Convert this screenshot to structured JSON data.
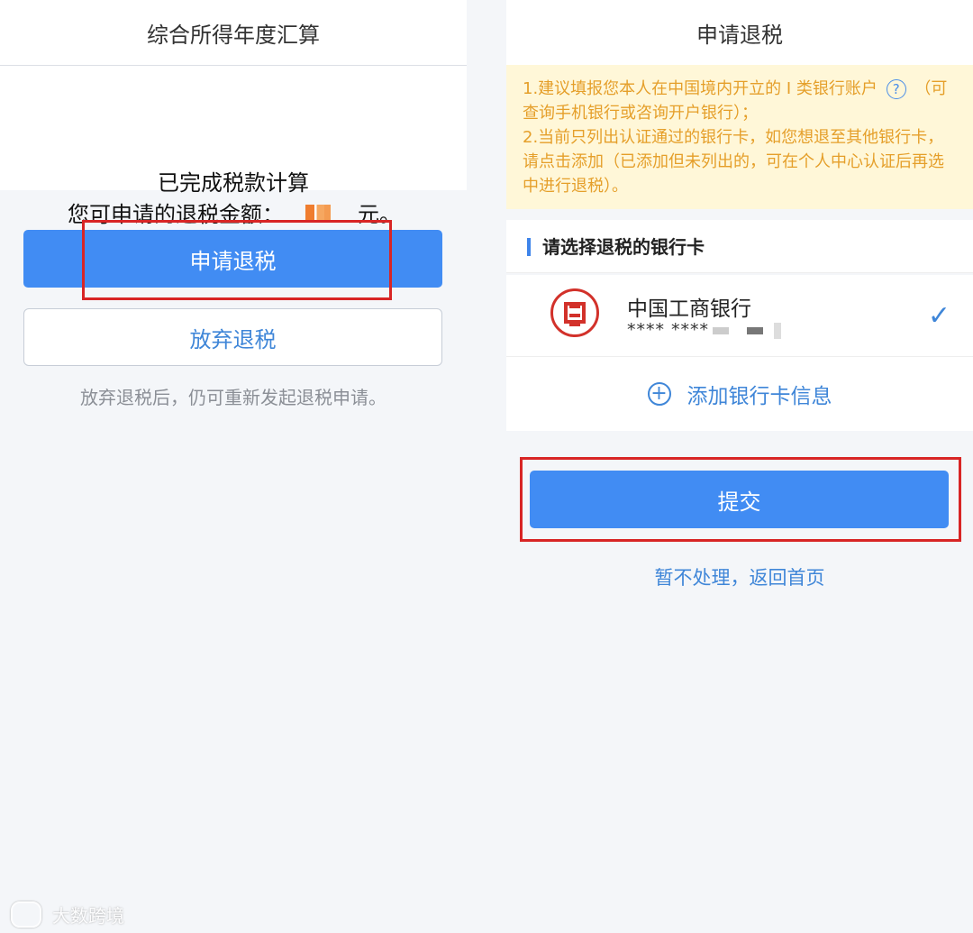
{
  "left": {
    "title": "综合所得年度汇算",
    "done_text": "已完成税款计算",
    "amount_label": "您可申请的退税金额：",
    "amount_suffix": "元。",
    "apply_button": "申请退税",
    "abandon_button": "放弃退税",
    "hint": "放弃退税后，仍可重新发起退税申请。"
  },
  "right": {
    "title": "申请退税",
    "notice": [
      "1.建议填报您本人在中国境内开立的 I 类银行账户",
      "（可查询手机银行或咨询开户银行）；",
      "2.当前只列出认证通过的银行卡，如您想退至其他银行卡，请点击添加（已添加但未列出的，可在个人中心认证后再选中进行退税）。"
    ],
    "section_title": "请选择退税的银行卡",
    "bank_name": "中国工商银行",
    "card_number": "**** ****",
    "add_card": "添加银行卡信息",
    "submit": "提交",
    "later_link": "暂不处理，返回首页",
    "help_icon": "question-circle-icon",
    "selected_icon": "check-icon",
    "plus_icon": "plus-circle-icon"
  },
  "watermark": "大数跨境",
  "colors": {
    "primary": "#418cf3",
    "highlight": "#d82525",
    "notice_text": "#e59f2a",
    "notice_bg": "#fff7d8"
  }
}
